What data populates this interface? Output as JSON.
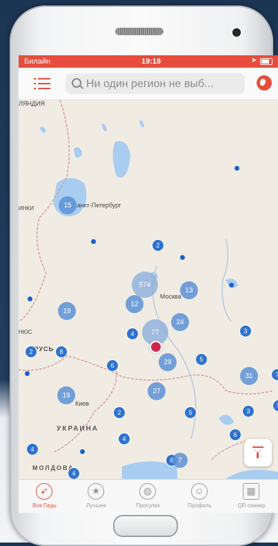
{
  "status_bar": {
    "carrier": "Билайн",
    "time": "19:18"
  },
  "search": {
    "placeholder": "Ни один регион не выб..."
  },
  "map": {
    "labels": {
      "city_spb": "Санкт-Петербург",
      "city_moscow": "Москва",
      "city_kiev": "Киев",
      "country_ukraine": "УКРАИНА",
      "country_moldova": "МОЛДОВА",
      "top_fragment": "ЛЯНДИЯ",
      "left_fragment_1": "ИНКИ",
      "left_fragment_2": "НЮС",
      "left_fragment_3": "АРУСЬ"
    },
    "clusters": {
      "spb": "15",
      "a": "2",
      "moscow_big": "574",
      "moscow_r": "13",
      "moscow_l": "12",
      "b": "19",
      "c": "4",
      "d": "77",
      "e": "24",
      "f": "3",
      "g": "8",
      "h": "2",
      "i": "29",
      "j": "5",
      "k": "6",
      "l": "31",
      "m": "7",
      "n": "27",
      "o": "19",
      "p": "2",
      "q": "5",
      "r": "3",
      "s": "4",
      "t": "6",
      "u": "4",
      "v": "5",
      "w": "8",
      "x": "7",
      "y": "4"
    }
  },
  "tabs": [
    {
      "label": "Все Гиды"
    },
    {
      "label": "Лучшее"
    },
    {
      "label": "Прогулка"
    },
    {
      "label": "Профиль"
    },
    {
      "label": "QR-сканер"
    }
  ],
  "colors": {
    "accent": "#e74c3c",
    "cluster": "#2f73cf",
    "user_location": "#d0264c"
  }
}
